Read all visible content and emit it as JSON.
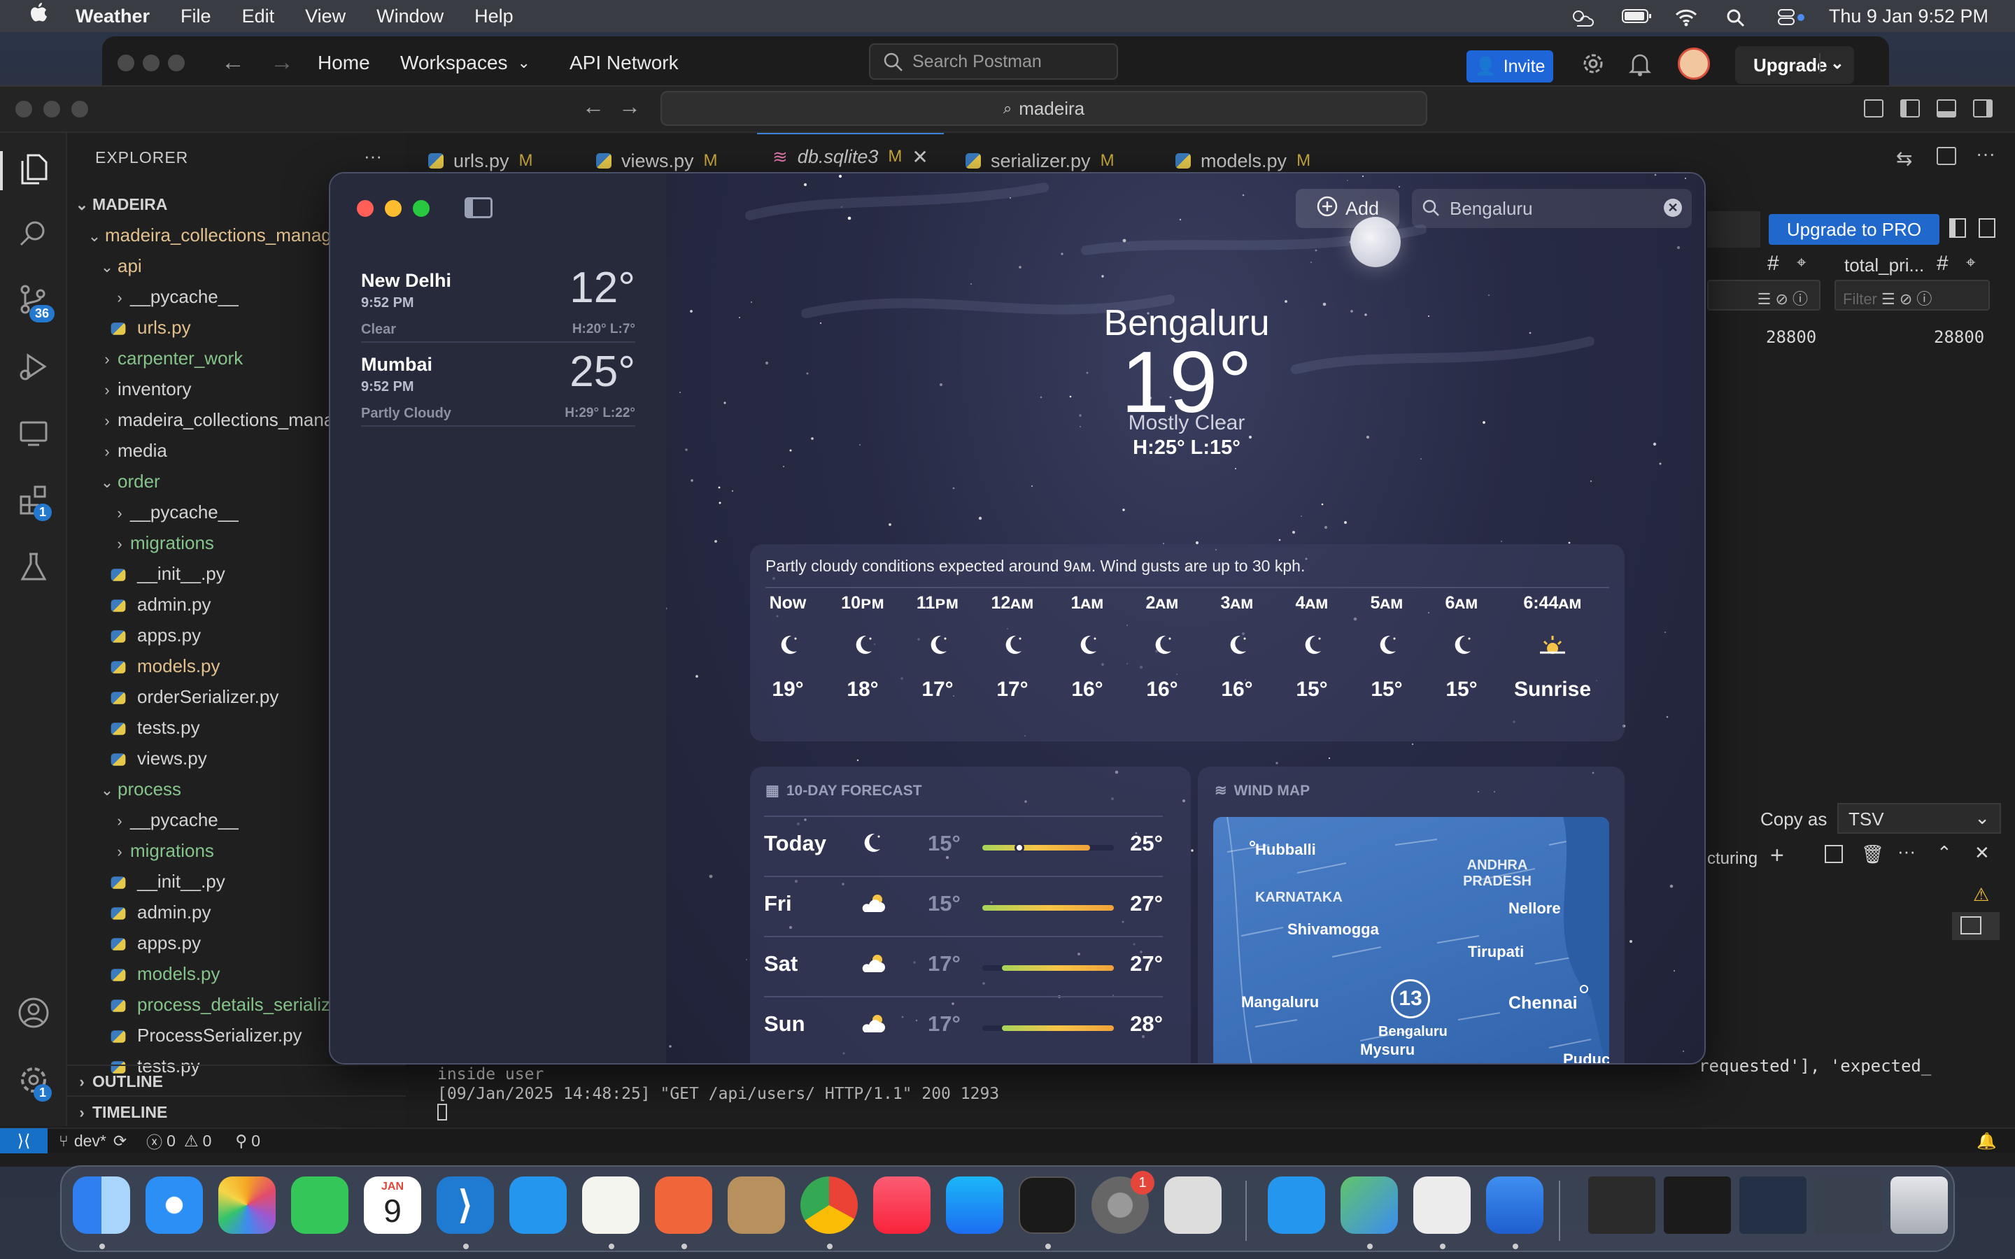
{
  "menubar": {
    "app_name": "Weather",
    "items": [
      "File",
      "Edit",
      "View",
      "Window",
      "Help"
    ],
    "datetime": "Thu 9 Jan  9:52 PM"
  },
  "postman": {
    "nav": [
      "Home",
      "Workspaces",
      "API Network"
    ],
    "search_placeholder": "Search Postman",
    "invite_label": "Invite",
    "upgrade_label": "Upgrade"
  },
  "vscode": {
    "search_text": "madeira",
    "explorer_title": "EXPLORER",
    "more": "···",
    "tabs": [
      {
        "name": "urls.py",
        "mark": "M"
      },
      {
        "name": "views.py",
        "mark": "M"
      },
      {
        "name": "db.sqlite3",
        "mark": "M"
      },
      {
        "name": "serializer.py",
        "mark": "M"
      },
      {
        "name": "models.py",
        "mark": "M"
      }
    ],
    "activity_badges": {
      "source_control": "36",
      "extensions": "1",
      "settings": "1"
    },
    "tree": [
      {
        "label": "MADEIRA",
        "type": "root"
      },
      {
        "label": "madeira_collections_management",
        "type": "folder-open",
        "color": "yellow",
        "indent": 1
      },
      {
        "label": "api",
        "type": "folder-open",
        "color": "yellow",
        "indent": 2
      },
      {
        "label": "__pycache__",
        "type": "folder",
        "indent": 3
      },
      {
        "label": "urls.py",
        "type": "py",
        "color": "yellow",
        "indent": 3
      },
      {
        "label": "carpenter_work",
        "type": "folder",
        "color": "green",
        "indent": 2
      },
      {
        "label": "inventory",
        "type": "folder",
        "indent": 2
      },
      {
        "label": "madeira_collections_management",
        "type": "folder",
        "indent": 2
      },
      {
        "label": "media",
        "type": "folder",
        "indent": 2
      },
      {
        "label": "order",
        "type": "folder-open",
        "color": "green",
        "indent": 2
      },
      {
        "label": "__pycache__",
        "type": "folder",
        "indent": 3
      },
      {
        "label": "migrations",
        "type": "folder",
        "color": "green",
        "indent": 3
      },
      {
        "label": "__init__.py",
        "type": "py",
        "indent": 3
      },
      {
        "label": "admin.py",
        "type": "py",
        "indent": 3
      },
      {
        "label": "apps.py",
        "type": "py",
        "indent": 3
      },
      {
        "label": "models.py",
        "type": "py",
        "color": "yellow",
        "indent": 3
      },
      {
        "label": "orderSerializer.py",
        "type": "py",
        "indent": 3
      },
      {
        "label": "tests.py",
        "type": "py",
        "indent": 3
      },
      {
        "label": "views.py",
        "type": "py",
        "indent": 3
      },
      {
        "label": "process",
        "type": "folder-open",
        "color": "green",
        "indent": 2
      },
      {
        "label": "__pycache__",
        "type": "folder",
        "indent": 3
      },
      {
        "label": "migrations",
        "type": "folder",
        "color": "green",
        "indent": 3
      },
      {
        "label": "__init__.py",
        "type": "py",
        "indent": 3
      },
      {
        "label": "admin.py",
        "type": "py",
        "indent": 3
      },
      {
        "label": "apps.py",
        "type": "py",
        "indent": 3
      },
      {
        "label": "models.py",
        "type": "py",
        "color": "green",
        "indent": 3
      },
      {
        "label": "process_details_serializer.py",
        "type": "py",
        "color": "green",
        "indent": 3
      },
      {
        "label": "ProcessSerializer.py",
        "type": "py",
        "indent": 3
      },
      {
        "label": "tests.py",
        "type": "py",
        "indent": 3
      }
    ],
    "outline_label": "OUTLINE",
    "timeline_label": "TIMELINE",
    "terminal_lines": [
      "inside user",
      "[09/Jan/2025 14:48:25] \"GET /api/users/ HTTP/1.1\" 200 1293"
    ],
    "status": {
      "branch": "dev*",
      "errors": "0",
      "warnings": "0",
      "ports": "0"
    },
    "right_panel": {
      "upgrade_pro": "Upgrade to PRO",
      "column": "total_pri...",
      "filter_placeholder": "Filter",
      "value1": "28800",
      "value2": "28800",
      "copy_as": "Copy as",
      "format": "TSV",
      "panel_label": "cturing",
      "snippet": "requested'], 'expected_"
    }
  },
  "weather": {
    "sidebar_cities": [
      {
        "name": "New Delhi",
        "time": "9:52 PM",
        "condition": "Clear",
        "temp": "12°",
        "hilo": "H:20°  L:7°"
      },
      {
        "name": "Mumbai",
        "time": "9:52 PM",
        "condition": "Partly Cloudy",
        "temp": "25°",
        "hilo": "H:29°  L:22°"
      }
    ],
    "add_label": "Add",
    "search_value": "Bengaluru",
    "city": "Bengaluru",
    "temp": "19°",
    "condition": "Mostly Clear",
    "hilo": "H:25°  L:15°",
    "summary": "Partly cloudy conditions expected around 9ᴀᴍ. Wind gusts are up to 30 kph.",
    "hourly": [
      {
        "h": "Now",
        "icon": "moon-icon",
        "t": "19°"
      },
      {
        "h": "10ᴘᴍ",
        "icon": "moon-icon",
        "t": "18°"
      },
      {
        "h": "11ᴘᴍ",
        "icon": "moon-icon",
        "t": "17°"
      },
      {
        "h": "12ᴀᴍ",
        "icon": "moon-icon",
        "t": "17°"
      },
      {
        "h": "1ᴀᴍ",
        "icon": "moon-icon",
        "t": "16°"
      },
      {
        "h": "2ᴀᴍ",
        "icon": "moon-icon",
        "t": "16°"
      },
      {
        "h": "3ᴀᴍ",
        "icon": "moon-icon",
        "t": "16°"
      },
      {
        "h": "4ᴀᴍ",
        "icon": "moon-icon",
        "t": "15°"
      },
      {
        "h": "5ᴀᴍ",
        "icon": "moon-icon",
        "t": "15°"
      },
      {
        "h": "6ᴀᴍ",
        "icon": "moon-icon",
        "t": "15°"
      },
      {
        "h": "6:44ᴀᴍ",
        "icon": "sunrise-icon",
        "t": "Sunrise"
      }
    ],
    "forecast_title": "10-DAY FORECAST",
    "forecast": [
      {
        "day": "Today",
        "icon": "moon-icon",
        "lo": "15°",
        "hi": "25°",
        "range": [
          0.0,
          0.82
        ],
        "current": 0.28
      },
      {
        "day": "Fri",
        "icon": "partly-sunny-icon",
        "lo": "15°",
        "hi": "27°",
        "range": [
          0.0,
          1.0
        ]
      },
      {
        "day": "Sat",
        "icon": "partly-sunny-icon",
        "lo": "17°",
        "hi": "27°",
        "range": [
          0.15,
          1.0
        ]
      },
      {
        "day": "Sun",
        "icon": "partly-sunny-icon",
        "lo": "17°",
        "hi": "28°",
        "range": [
          0.15,
          1.0
        ]
      }
    ],
    "wind_title": "WIND MAP",
    "map_labels": [
      "Hubballi",
      "ANDHRA PRADESH",
      "KARNATAKA",
      "Nellore",
      "Shivamogga",
      "Tirupati",
      "Mangaluru",
      "Chennai",
      "Bengaluru",
      "Mysuru",
      "Puduc"
    ],
    "map_badge": "13"
  },
  "dock": {
    "calendar_month": "JAN",
    "calendar_day": "9",
    "settings_badge": "1"
  }
}
